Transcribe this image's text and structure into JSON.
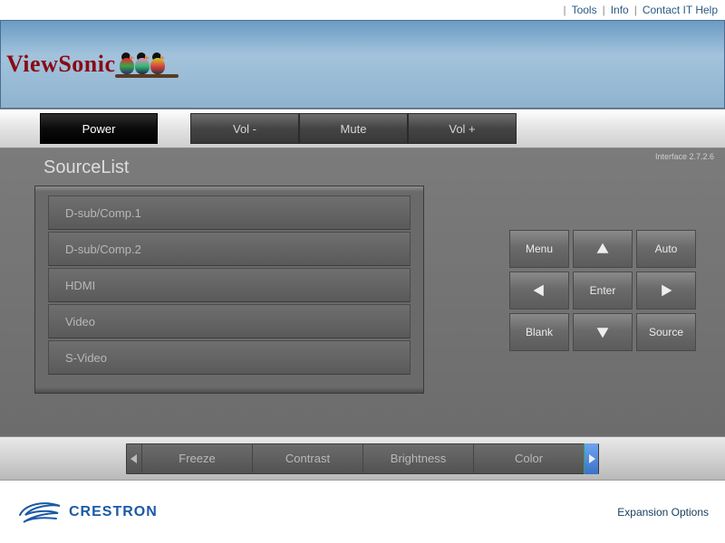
{
  "topnav": {
    "tools": "Tools",
    "info": "Info",
    "contact": "Contact IT Help"
  },
  "brand": "ViewSonic",
  "toolbar": {
    "power": "Power",
    "voldown": "Vol -",
    "mute": "Mute",
    "volup": "Vol +"
  },
  "interface_version": "Interface 2.7.2.6",
  "source_list": {
    "label": "SourceList",
    "items": [
      "D-sub/Comp.1",
      "D-sub/Comp.2",
      "HDMI",
      "Video",
      "S-Video"
    ]
  },
  "keypad": {
    "menu": "Menu",
    "auto": "Auto",
    "enter": "Enter",
    "blank": "Blank",
    "source": "Source"
  },
  "slider": {
    "items": [
      "Freeze",
      "Contrast",
      "Brightness",
      "Color"
    ]
  },
  "footer": {
    "logo": "CRESTRON",
    "expansion": "Expansion Options"
  }
}
